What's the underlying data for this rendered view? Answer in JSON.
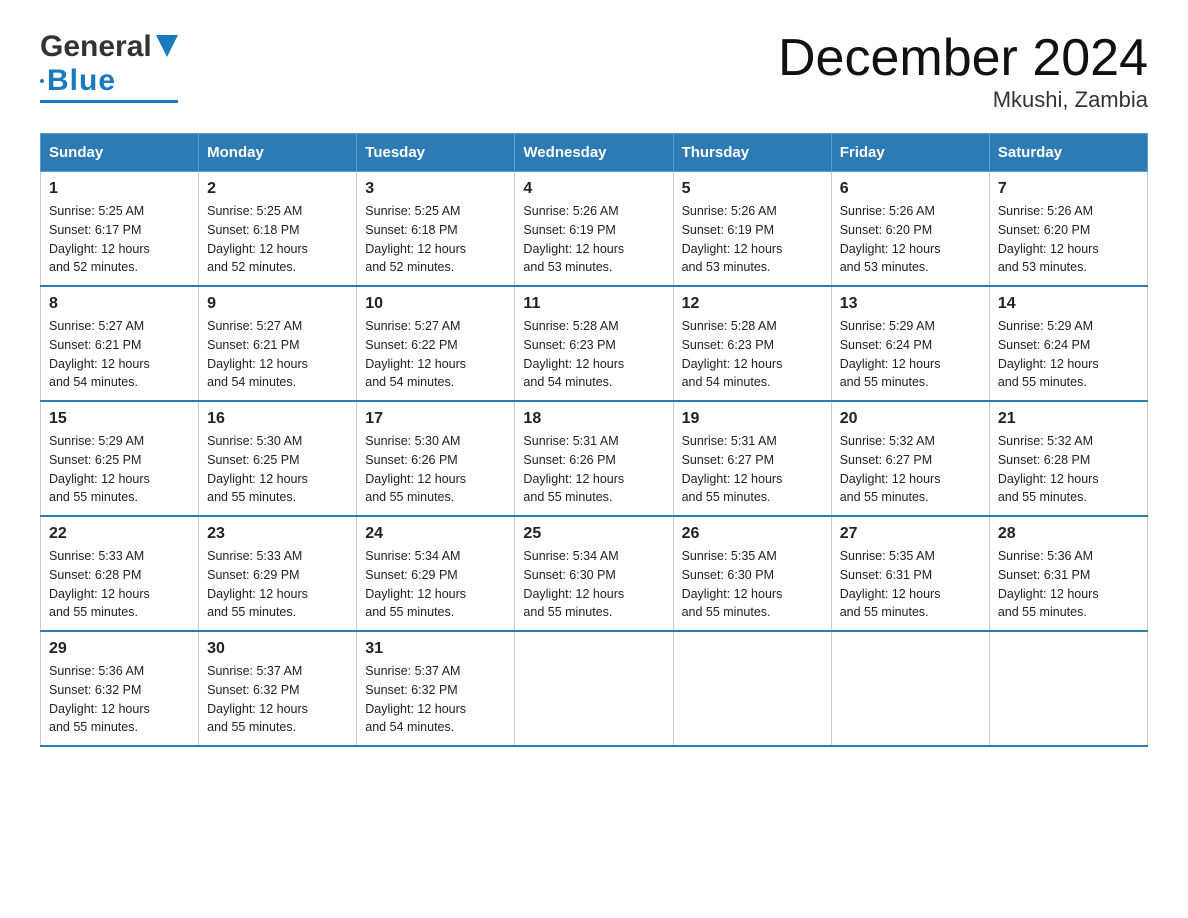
{
  "header": {
    "logo_general": "General",
    "logo_blue": "Blue",
    "month_title": "December 2024",
    "location": "Mkushi, Zambia"
  },
  "days_of_week": [
    "Sunday",
    "Monday",
    "Tuesday",
    "Wednesday",
    "Thursday",
    "Friday",
    "Saturday"
  ],
  "weeks": [
    [
      {
        "day": "1",
        "sunrise": "5:25 AM",
        "sunset": "6:17 PM",
        "daylight": "12 hours and 52 minutes."
      },
      {
        "day": "2",
        "sunrise": "5:25 AM",
        "sunset": "6:18 PM",
        "daylight": "12 hours and 52 minutes."
      },
      {
        "day": "3",
        "sunrise": "5:25 AM",
        "sunset": "6:18 PM",
        "daylight": "12 hours and 52 minutes."
      },
      {
        "day": "4",
        "sunrise": "5:26 AM",
        "sunset": "6:19 PM",
        "daylight": "12 hours and 53 minutes."
      },
      {
        "day": "5",
        "sunrise": "5:26 AM",
        "sunset": "6:19 PM",
        "daylight": "12 hours and 53 minutes."
      },
      {
        "day": "6",
        "sunrise": "5:26 AM",
        "sunset": "6:20 PM",
        "daylight": "12 hours and 53 minutes."
      },
      {
        "day": "7",
        "sunrise": "5:26 AM",
        "sunset": "6:20 PM",
        "daylight": "12 hours and 53 minutes."
      }
    ],
    [
      {
        "day": "8",
        "sunrise": "5:27 AM",
        "sunset": "6:21 PM",
        "daylight": "12 hours and 54 minutes."
      },
      {
        "day": "9",
        "sunrise": "5:27 AM",
        "sunset": "6:21 PM",
        "daylight": "12 hours and 54 minutes."
      },
      {
        "day": "10",
        "sunrise": "5:27 AM",
        "sunset": "6:22 PM",
        "daylight": "12 hours and 54 minutes."
      },
      {
        "day": "11",
        "sunrise": "5:28 AM",
        "sunset": "6:23 PM",
        "daylight": "12 hours and 54 minutes."
      },
      {
        "day": "12",
        "sunrise": "5:28 AM",
        "sunset": "6:23 PM",
        "daylight": "12 hours and 54 minutes."
      },
      {
        "day": "13",
        "sunrise": "5:29 AM",
        "sunset": "6:24 PM",
        "daylight": "12 hours and 55 minutes."
      },
      {
        "day": "14",
        "sunrise": "5:29 AM",
        "sunset": "6:24 PM",
        "daylight": "12 hours and 55 minutes."
      }
    ],
    [
      {
        "day": "15",
        "sunrise": "5:29 AM",
        "sunset": "6:25 PM",
        "daylight": "12 hours and 55 minutes."
      },
      {
        "day": "16",
        "sunrise": "5:30 AM",
        "sunset": "6:25 PM",
        "daylight": "12 hours and 55 minutes."
      },
      {
        "day": "17",
        "sunrise": "5:30 AM",
        "sunset": "6:26 PM",
        "daylight": "12 hours and 55 minutes."
      },
      {
        "day": "18",
        "sunrise": "5:31 AM",
        "sunset": "6:26 PM",
        "daylight": "12 hours and 55 minutes."
      },
      {
        "day": "19",
        "sunrise": "5:31 AM",
        "sunset": "6:27 PM",
        "daylight": "12 hours and 55 minutes."
      },
      {
        "day": "20",
        "sunrise": "5:32 AM",
        "sunset": "6:27 PM",
        "daylight": "12 hours and 55 minutes."
      },
      {
        "day": "21",
        "sunrise": "5:32 AM",
        "sunset": "6:28 PM",
        "daylight": "12 hours and 55 minutes."
      }
    ],
    [
      {
        "day": "22",
        "sunrise": "5:33 AM",
        "sunset": "6:28 PM",
        "daylight": "12 hours and 55 minutes."
      },
      {
        "day": "23",
        "sunrise": "5:33 AM",
        "sunset": "6:29 PM",
        "daylight": "12 hours and 55 minutes."
      },
      {
        "day": "24",
        "sunrise": "5:34 AM",
        "sunset": "6:29 PM",
        "daylight": "12 hours and 55 minutes."
      },
      {
        "day": "25",
        "sunrise": "5:34 AM",
        "sunset": "6:30 PM",
        "daylight": "12 hours and 55 minutes."
      },
      {
        "day": "26",
        "sunrise": "5:35 AM",
        "sunset": "6:30 PM",
        "daylight": "12 hours and 55 minutes."
      },
      {
        "day": "27",
        "sunrise": "5:35 AM",
        "sunset": "6:31 PM",
        "daylight": "12 hours and 55 minutes."
      },
      {
        "day": "28",
        "sunrise": "5:36 AM",
        "sunset": "6:31 PM",
        "daylight": "12 hours and 55 minutes."
      }
    ],
    [
      {
        "day": "29",
        "sunrise": "5:36 AM",
        "sunset": "6:32 PM",
        "daylight": "12 hours and 55 minutes."
      },
      {
        "day": "30",
        "sunrise": "5:37 AM",
        "sunset": "6:32 PM",
        "daylight": "12 hours and 55 minutes."
      },
      {
        "day": "31",
        "sunrise": "5:37 AM",
        "sunset": "6:32 PM",
        "daylight": "12 hours and 54 minutes."
      },
      null,
      null,
      null,
      null
    ]
  ],
  "labels": {
    "sunrise": "Sunrise:",
    "sunset": "Sunset:",
    "daylight": "Daylight:"
  }
}
